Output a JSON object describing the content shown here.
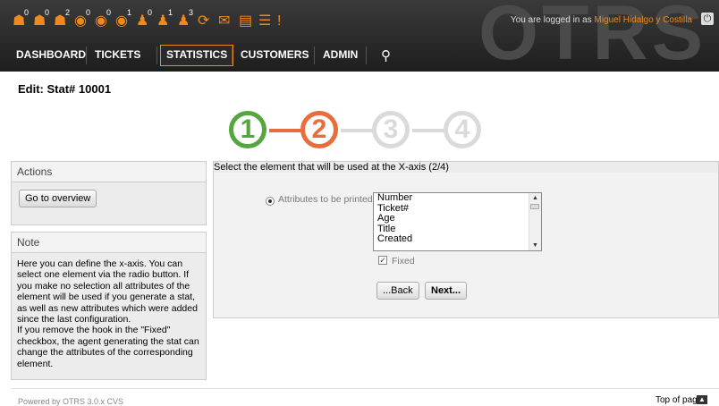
{
  "header": {
    "watermark": "OTRS",
    "toolbar": [
      {
        "icon": "locked-tickets-new-icon",
        "glyph": "☗",
        "count": "0"
      },
      {
        "icon": "locked-tickets-reached-icon",
        "glyph": "☗",
        "count": "0"
      },
      {
        "icon": "locked-tickets-total-icon",
        "glyph": "☗",
        "count": "2"
      },
      {
        "icon": "watched-tickets-new-icon",
        "glyph": "◉",
        "count": "0"
      },
      {
        "icon": "watched-tickets-reached-icon",
        "glyph": "◉",
        "count": "0"
      },
      {
        "icon": "watched-tickets-total-icon",
        "glyph": "◉",
        "count": "1"
      },
      {
        "icon": "responsible-new-icon",
        "glyph": "♟",
        "count": "0"
      },
      {
        "icon": "responsible-reached-icon",
        "glyph": "♟",
        "count": "1"
      },
      {
        "icon": "responsible-total-icon",
        "glyph": "♟",
        "count": "3"
      },
      {
        "icon": "reload-icon",
        "glyph": "⟳",
        "count": ""
      },
      {
        "icon": "new-email-ticket-icon",
        "glyph": "✉",
        "count": ""
      },
      {
        "icon": "queue-view-icon",
        "glyph": "▤",
        "count": ""
      },
      {
        "icon": "status-view-icon",
        "glyph": "☰",
        "count": ""
      },
      {
        "icon": "escalation-view-icon",
        "glyph": "!",
        "count": ""
      }
    ],
    "login_prefix": "You are logged in as",
    "user_name": "Miguel Hidalgo y Costilla",
    "logout_glyph": "⏻"
  },
  "nav": {
    "items": [
      "DASHBOARD",
      "TICKETS",
      "STATISTICS",
      "CUSTOMERS",
      "ADMIN"
    ],
    "active": "STATISTICS",
    "search_glyph": "⚲"
  },
  "page_title": "Edit: Stat# 10001",
  "steps": [
    {
      "number": "1",
      "color": "#55a641"
    },
    {
      "number": "2",
      "color": "#e96c3d"
    },
    {
      "number": "3",
      "color": "#dadada"
    },
    {
      "number": "4",
      "color": "#dadada"
    }
  ],
  "actions": {
    "title": "Actions",
    "overview_button": "Go to overview"
  },
  "note": {
    "title": "Note",
    "text1": "Here you can define the x-axis. You can select one element via the radio button. If you make no selection all attributes of the element will be used if you generate a stat, as well as new attributes which were added since the last configuration.",
    "text2": "If you remove the hook in the \"Fixed\" checkbox, the agent generating the stat can change the attributes of the corresponding element."
  },
  "main": {
    "title": "Select the element that will be used at the X-axis (2/4)",
    "attribute_label": "Attributes to be printed:",
    "options": [
      "Number",
      "Ticket#",
      "Age",
      "Title",
      "Created"
    ],
    "fixed_label": "Fixed",
    "fixed_checked": true,
    "back_button": "...Back",
    "next_button": "Next..."
  },
  "footer": {
    "powered_by": "Powered by OTRS 3.0.x CVS",
    "top_of_page": "Top of page"
  }
}
